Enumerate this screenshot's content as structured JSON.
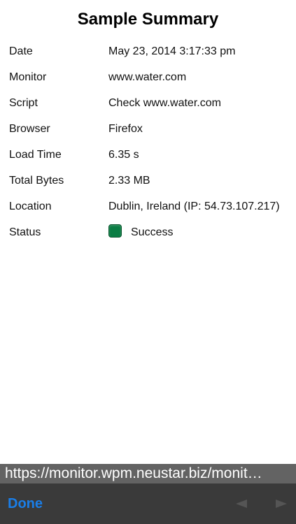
{
  "page": {
    "title": "Sample Summary"
  },
  "details": [
    {
      "label": "Date",
      "value": "May 23, 2014 3:17:33 pm"
    },
    {
      "label": "Monitor",
      "value": "www.water.com"
    },
    {
      "label": "Script",
      "value": "Check www.water.com"
    },
    {
      "label": "Browser",
      "value": "Firefox"
    },
    {
      "label": "Load Time",
      "value": "6.35 s"
    },
    {
      "label": "Total Bytes",
      "value": "2.33 MB"
    },
    {
      "label": "Location",
      "value": "Dublin, Ireland (IP: 54.73.107.217)"
    }
  ],
  "status": {
    "label": "Status",
    "value": "Success",
    "color": "#0b7d44"
  },
  "url_bar": {
    "text": "https://monitor.wpm.neustar.biz/monit…"
  },
  "toolbar": {
    "done_label": "Done",
    "back_icon": "back-arrow-icon",
    "forward_icon": "forward-arrow-icon"
  },
  "colors": {
    "accent": "#1a7ee8",
    "toolbar_bg": "#3a3a3a",
    "url_bar_bg": "#636363",
    "disabled_arrow": "#555555"
  }
}
